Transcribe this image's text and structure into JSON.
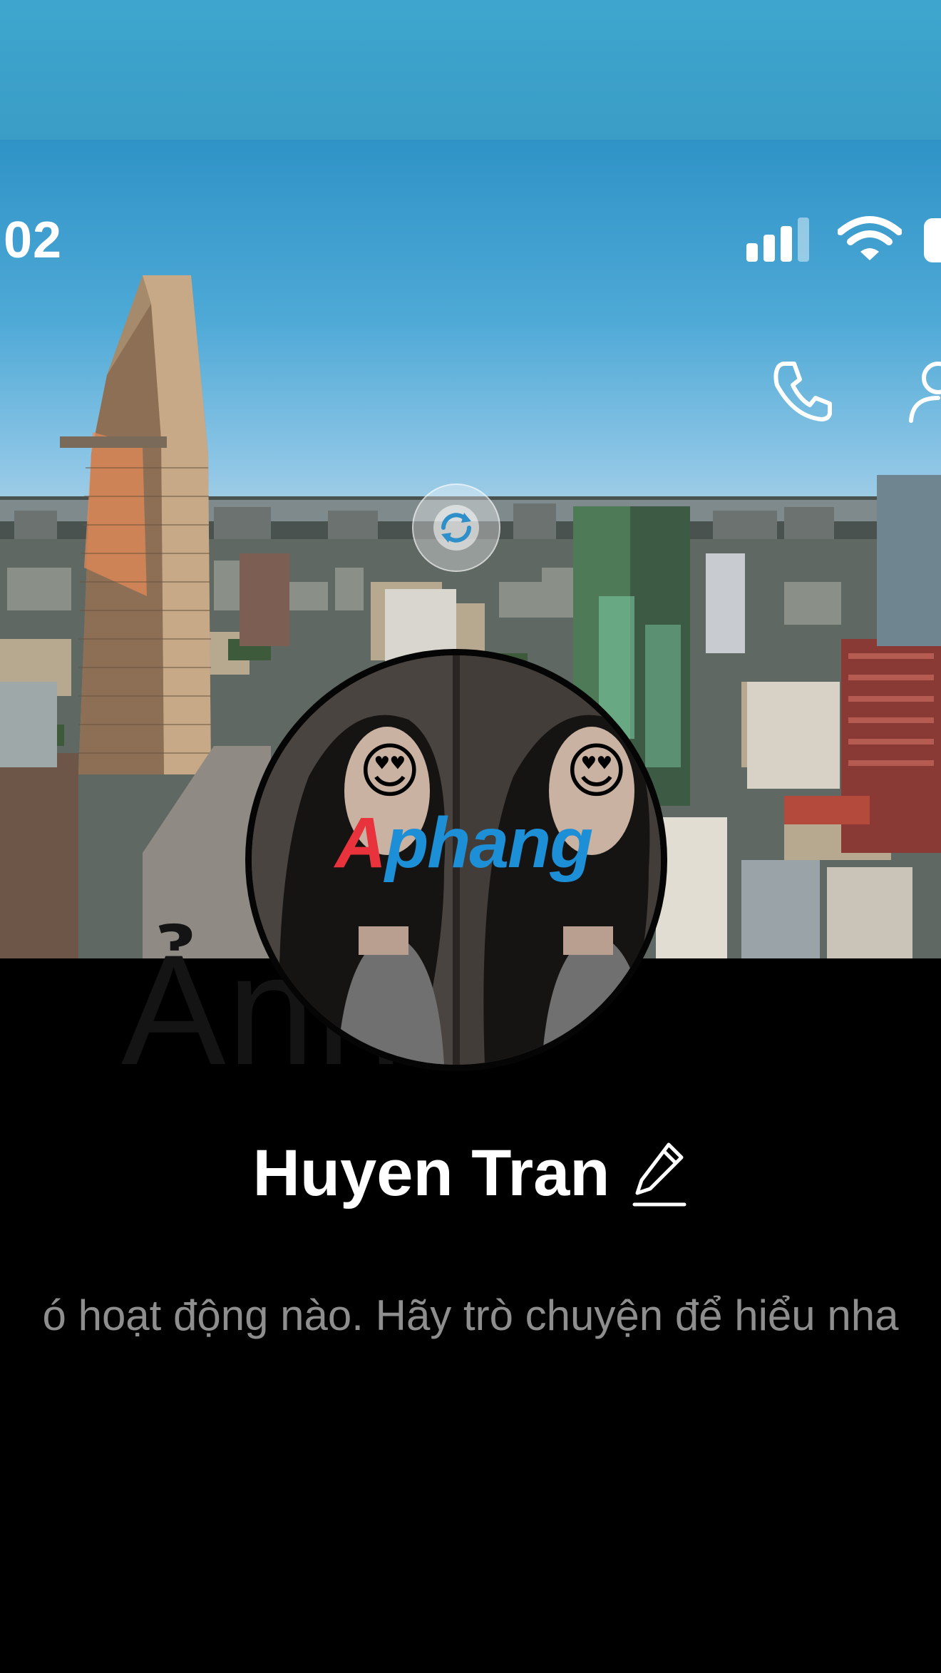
{
  "status_bar": {
    "time": ":02",
    "signal_icon": "cellular-signal-icon",
    "wifi_icon": "wifi-icon",
    "battery_icon": "battery-icon"
  },
  "header_actions": {
    "call_icon": "phone-icon",
    "add_friend_icon": "add-friend-icon"
  },
  "cover": {
    "change_cover_icon": "refresh-camera-icon"
  },
  "avatar": {
    "overlay_emoji": "😍",
    "brand_prefix": "A",
    "brand_suffix": "phang"
  },
  "background_watermark": "Ảnh b",
  "profile": {
    "name": "Huyen Tran",
    "edit_icon": "pencil-icon"
  },
  "empty_state": {
    "message": "ó hoạt động nào. Hãy trò chuyện để hiểu nha"
  },
  "colors": {
    "top_band": "#3ea6ce",
    "background": "#000000",
    "name_text": "#ffffff",
    "secondary_text": "#8e8e8e",
    "brand_red": "#e8323c",
    "brand_blue": "#1c8fd6"
  }
}
